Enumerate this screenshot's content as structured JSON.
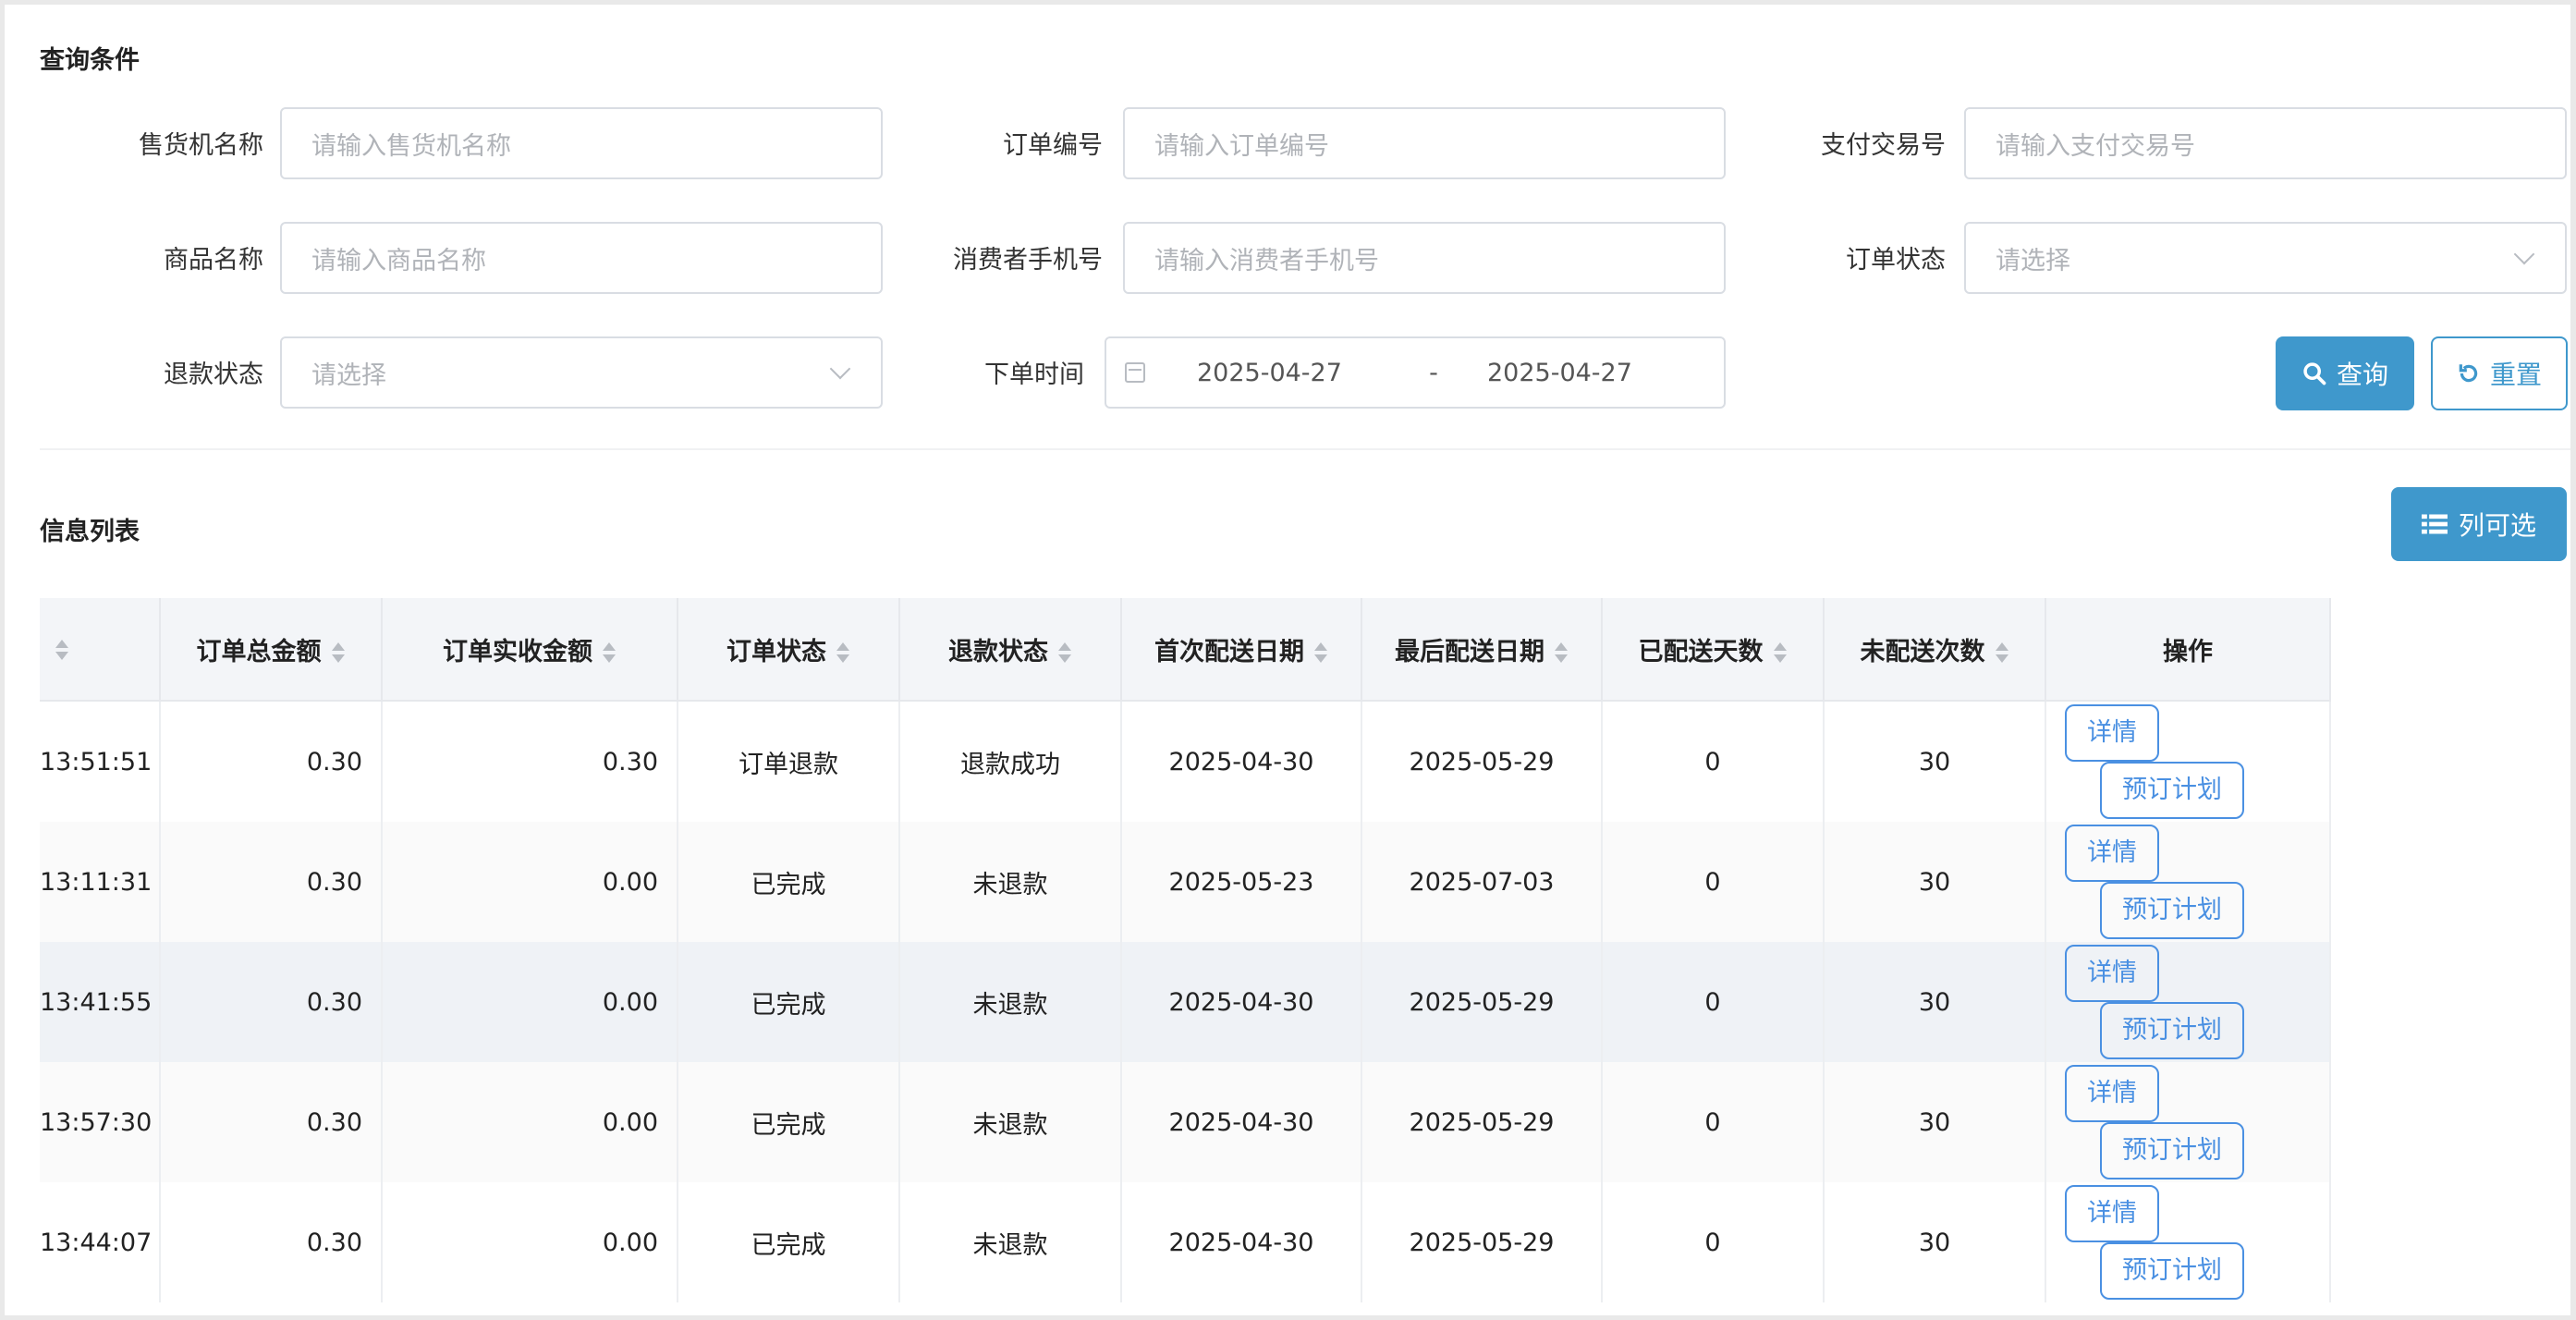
{
  "query": {
    "title": "查询条件",
    "fields": {
      "machine_name": {
        "label": "售货机名称",
        "placeholder": "请输入售货机名称"
      },
      "order_no": {
        "label": "订单编号",
        "placeholder": "请输入订单编号"
      },
      "pay_trade_no": {
        "label": "支付交易号",
        "placeholder": "请输入支付交易号"
      },
      "product_name": {
        "label": "商品名称",
        "placeholder": "请输入商品名称"
      },
      "consumer_phone": {
        "label": "消费者手机号",
        "placeholder": "请输入消费者手机号"
      },
      "order_status": {
        "label": "订单状态",
        "placeholder": "请选择"
      },
      "refund_status": {
        "label": "退款状态",
        "placeholder": "请选择"
      },
      "order_time": {
        "label": "下单时间",
        "start": "2025-04-27",
        "separator": "-",
        "end": "2025-04-27"
      }
    },
    "search_button": "查询",
    "reset_button": "重置"
  },
  "list": {
    "title": "信息列表",
    "columns_button": "列可选",
    "columns": [
      "",
      "订单总金额",
      "订单实收金额",
      "订单状态",
      "退款状态",
      "首次配送日期",
      "最后配送日期",
      "已配送天数",
      "未配送次数",
      "操作"
    ],
    "rows": [
      {
        "time": "13:51:51",
        "total": "0.30",
        "paid": "0.30",
        "order_status": "订单退款",
        "refund_status": "退款成功",
        "first_date": "2025-04-30",
        "last_date": "2025-05-29",
        "delivered_days": "0",
        "undelivered": "30"
      },
      {
        "time": "13:11:31",
        "total": "0.30",
        "paid": "0.00",
        "order_status": "已完成",
        "refund_status": "未退款",
        "first_date": "2025-05-23",
        "last_date": "2025-07-03",
        "delivered_days": "0",
        "undelivered": "30"
      },
      {
        "time": "13:41:55",
        "total": "0.30",
        "paid": "0.00",
        "order_status": "已完成",
        "refund_status": "未退款",
        "first_date": "2025-04-30",
        "last_date": "2025-05-29",
        "delivered_days": "0",
        "undelivered": "30"
      },
      {
        "time": "13:57:30",
        "total": "0.30",
        "paid": "0.00",
        "order_status": "已完成",
        "refund_status": "未退款",
        "first_date": "2025-04-30",
        "last_date": "2025-05-29",
        "delivered_days": "0",
        "undelivered": "30"
      },
      {
        "time": "13:44:07",
        "total": "0.30",
        "paid": "0.00",
        "order_status": "已完成",
        "refund_status": "未退款",
        "first_date": "2025-04-30",
        "last_date": "2025-05-29",
        "delivered_days": "0",
        "undelivered": "30"
      }
    ],
    "actions": {
      "detail": "详情",
      "plan": "预订计划"
    }
  },
  "colors": {
    "primary": "#3f98cc",
    "link": "#4a90e2",
    "refund": "#e06666",
    "success": "#5fae3a",
    "done": "#8a8a8a"
  },
  "icons": {
    "search_button": "search-icon",
    "reset_button": "refresh-icon",
    "columns_button": "list-icon",
    "date": "calendar-icon",
    "select": "chevron-down-icon",
    "sort": "sort-icon"
  }
}
